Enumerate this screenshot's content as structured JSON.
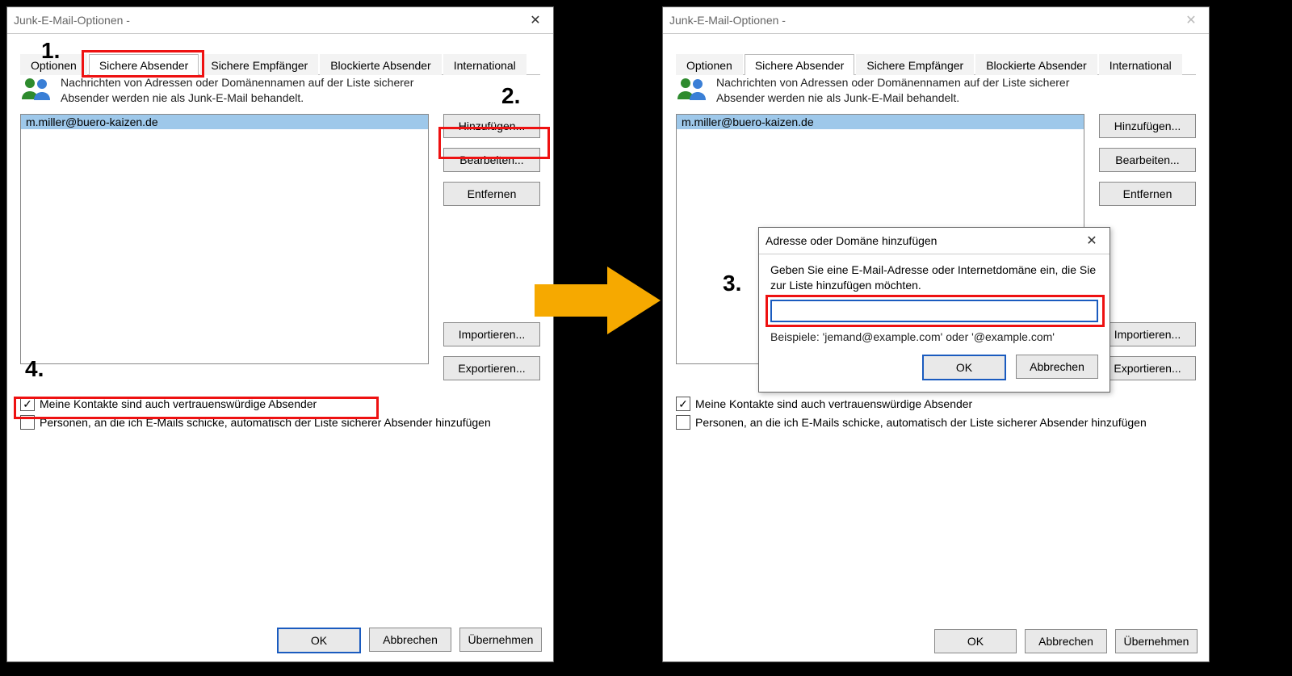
{
  "window_title": "Junk-E-Mail-Optionen - ",
  "tabs": [
    "Optionen",
    "Sichere Absender",
    "Sichere Empfänger",
    "Blockierte Absender",
    "International"
  ],
  "active_tab_index": 1,
  "description": "Nachrichten von Adressen oder Domänennamen auf der Liste sicherer Absender werden nie als Junk-E-Mail behandelt.",
  "list_items": [
    "m.miller@buero-kaizen.de"
  ],
  "side_buttons_top": [
    "Hinzufügen...",
    "Bearbeiten...",
    "Entfernen"
  ],
  "side_buttons_bottom": [
    "Importieren...",
    "Exportieren..."
  ],
  "check1": "Meine Kontakte sind auch vertrauenswürdige Absender",
  "check2": "Personen, an die ich E-Mails schicke, automatisch der Liste sicherer Absender hinzufügen",
  "footer_buttons": [
    "OK",
    "Abbrechen",
    "Übernehmen"
  ],
  "modal": {
    "title": "Adresse oder Domäne hinzufügen",
    "instruction": "Geben Sie eine E-Mail-Adresse oder Internetdomäne ein, die Sie zur Liste hinzufügen möchten.",
    "example": "Beispiele: 'jemand@example.com' oder '@example.com'",
    "ok": "OK",
    "cancel": "Abbrechen"
  },
  "anno": {
    "n1": "1.",
    "n2": "2.",
    "n3": "3.",
    "n4": "4."
  }
}
